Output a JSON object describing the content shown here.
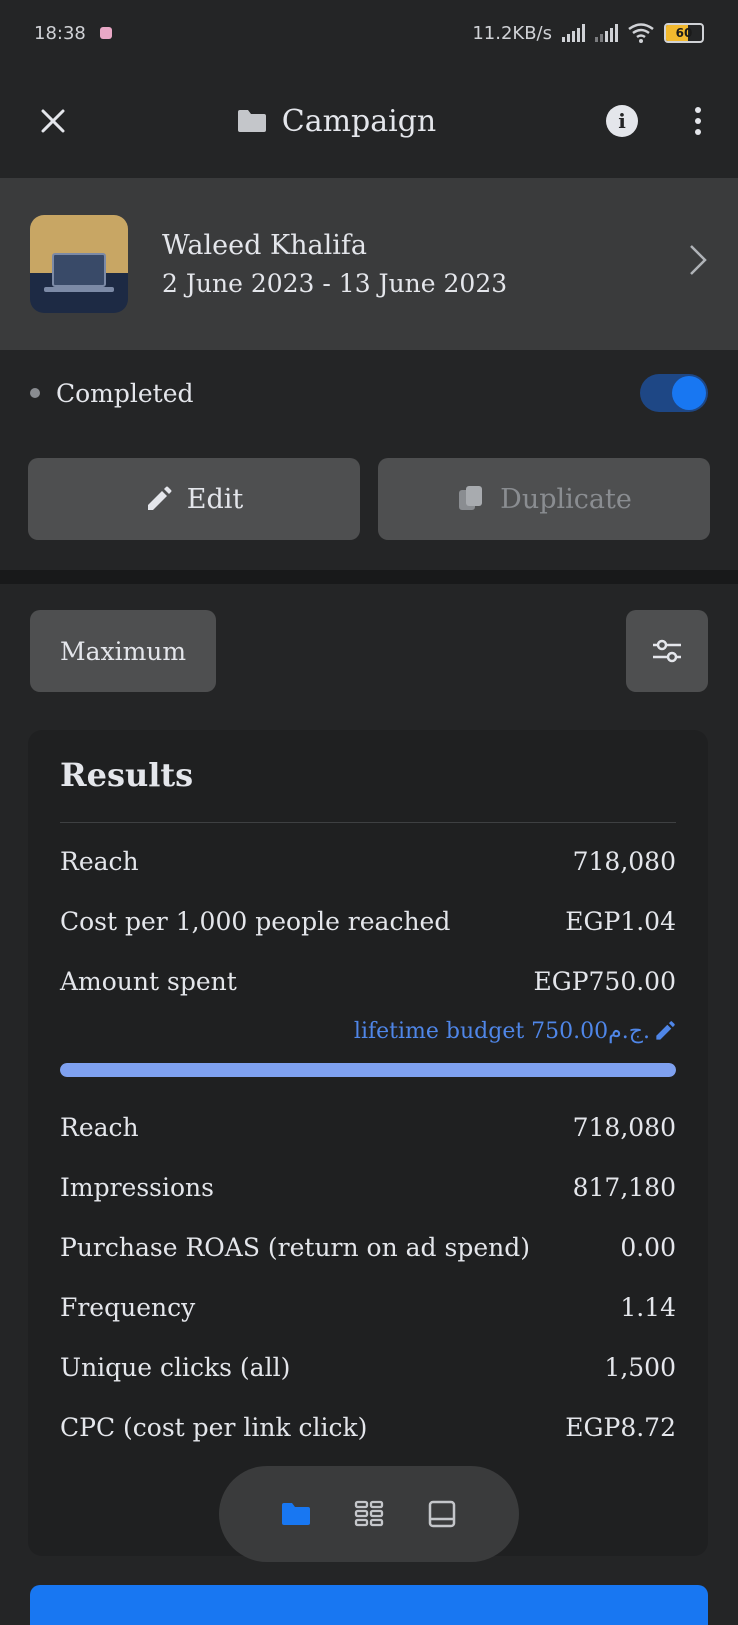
{
  "status_bar": {
    "time": "18:38",
    "network_speed": "11.2KB/s",
    "battery": "60",
    "battery_level": 0.6
  },
  "header": {
    "title": "Campaign",
    "icons": [
      "close-icon",
      "folder-icon",
      "info-icon",
      "more-icon"
    ]
  },
  "campaign": {
    "name": "Waleed Khalifa",
    "dates": "2 June 2023 - 13 June 2023"
  },
  "status": {
    "label": "Completed",
    "toggle_on": true
  },
  "actions": {
    "edit_label": "Edit",
    "duplicate_label": "Duplicate"
  },
  "filter": {
    "maximum_label": "Maximum"
  },
  "results": {
    "title": "Results",
    "primary_metrics": [
      {
        "label": "Reach",
        "value": "718,080"
      },
      {
        "label": "Cost per 1,000 people reached",
        "value": "EGP1.04"
      },
      {
        "label": "Amount spent",
        "value": "EGP750.00"
      }
    ],
    "budget_link": "lifetime budget 750.00ج.م.",
    "budget_progress": 1.0,
    "secondary_metrics": [
      {
        "label": "Reach",
        "value": "718,080"
      },
      {
        "label": "Impressions",
        "value": "817,180"
      },
      {
        "label": "Purchase ROAS (return on ad spend)",
        "value": "0.00"
      },
      {
        "label": "Frequency",
        "value": "1.14"
      },
      {
        "label": "Unique clicks (all)",
        "value": "1,500"
      },
      {
        "label": "CPC (cost per link click)",
        "value": "EGP8.72"
      }
    ]
  },
  "bottom_nav": {
    "items": [
      "folder-icon",
      "grid-icon",
      "ad-preview-icon"
    ],
    "active": 0
  },
  "colors": {
    "accent": "#1877f2",
    "background": "#242526",
    "card": "#3a3b3c",
    "progress": "#7fa1f0",
    "link": "#4f86e8"
  }
}
